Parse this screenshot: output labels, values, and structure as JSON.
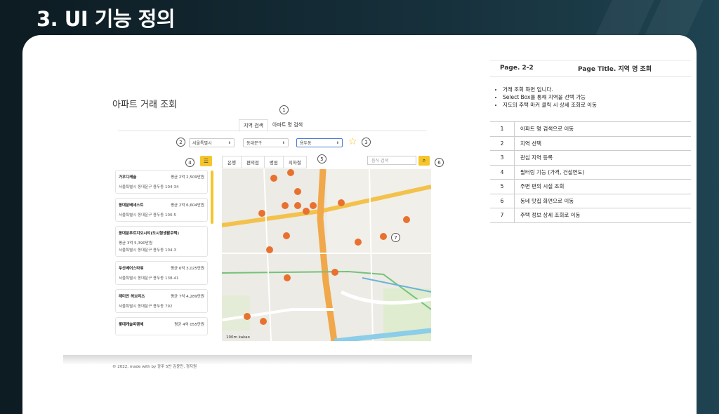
{
  "slide": {
    "title": "3. UI 기능 정의"
  },
  "app": {
    "title": "아파트 거래 조회",
    "tabs": [
      "지역 검색",
      "아파트 명 검색"
    ],
    "selects": {
      "city": "서울특별시",
      "district": "동대문구",
      "dong": "용두동"
    },
    "categories": [
      "은행",
      "편의점",
      "병원",
      "지하철"
    ],
    "restaurant_placeholder": "음식 검색",
    "icons": {
      "favorite": "star-icon",
      "filter": "filter-icon",
      "search": "search-icon"
    },
    "listings": [
      {
        "name": "가우디캐슬",
        "price": "평균 2억 2,509만원",
        "addr": "서울특별시 동대문구 용두동 104-34"
      },
      {
        "name": "동대문베네스트",
        "price": "평균 2억 6,604만원",
        "addr": "서울특별시 동대문구 용두동 100-5"
      },
      {
        "name": "동대문푸르지오시티(도시형생활주택)",
        "price": "평균 3억 5,390만원",
        "addr": "서울특별시 동대문구 용두동 104-3"
      },
      {
        "name": "두산베어스타워",
        "price": "평균 6억 3,025만원",
        "addr": "서울특별시 동대문구 용두동 138-41"
      },
      {
        "name": "래미안 허브리츠",
        "price": "평균 7억 4,289만원",
        "addr": "서울특별시 동대문구 용두동 792"
      },
      {
        "name": "롯데캐슬피렌체",
        "price": "평균 4억 055만원",
        "addr": ""
      }
    ],
    "map_scale": "100m",
    "map_logo": "kakao",
    "footer": "© 2022, made with by 광주 5반 김윤민, 정지원"
  },
  "callouts": [
    "1",
    "2",
    "3",
    "4",
    "5",
    "6",
    "7"
  ],
  "info": {
    "page": "Page. 2-2",
    "page_title": "Page Title. 지역 명 조회",
    "bullets": [
      "거래 조회 화면 입니다.",
      "Select Box를 통해 지역을 선택 가능",
      "지도의 주택 마커 클릭 시 상세 조회로 이동"
    ],
    "features": [
      {
        "no": "1",
        "desc": "아파트 명 검색으로 이동"
      },
      {
        "no": "2",
        "desc": "지역 선택"
      },
      {
        "no": "3",
        "desc": "관심 지역 등록"
      },
      {
        "no": "4",
        "desc": "필터링 기능 (가격, 건설연도)"
      },
      {
        "no": "5",
        "desc": "주변 편의 시설 조회"
      },
      {
        "no": "6",
        "desc": "동네 맛집 화면으로 이동"
      },
      {
        "no": "7",
        "desc": "주택 정보 상세 조회로 이동"
      }
    ]
  }
}
